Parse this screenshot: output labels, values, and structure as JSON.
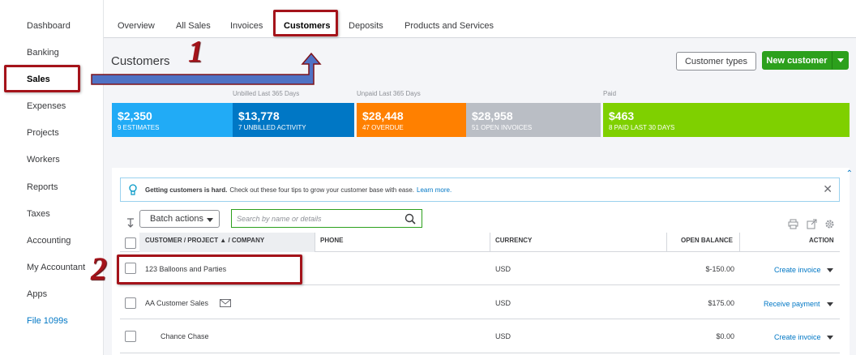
{
  "sidebar": {
    "items": [
      {
        "label": "Dashboard"
      },
      {
        "label": "Banking"
      },
      {
        "label": "Sales"
      },
      {
        "label": "Expenses"
      },
      {
        "label": "Projects"
      },
      {
        "label": "Workers"
      },
      {
        "label": "Reports"
      },
      {
        "label": "Taxes"
      },
      {
        "label": "Accounting"
      },
      {
        "label": "My Accountant"
      },
      {
        "label": "Apps"
      },
      {
        "label": "File 1099s"
      }
    ],
    "active": "Sales"
  },
  "tabs": [
    {
      "label": "Overview"
    },
    {
      "label": "All Sales"
    },
    {
      "label": "Invoices"
    },
    {
      "label": "Customers"
    },
    {
      "label": "Deposits"
    },
    {
      "label": "Products and Services"
    }
  ],
  "header": {
    "title": "Customers",
    "customer_types_label": "Customer types",
    "new_customer_label": "New customer"
  },
  "money_bar": {
    "labels": {
      "unbilled": "Unbilled Last 365 Days",
      "unpaid": "Unpaid Last 365 Days",
      "paid": "Paid"
    },
    "blocks": [
      {
        "amount": "$2,350",
        "sub": "9 ESTIMATES",
        "color": "#21abf6"
      },
      {
        "amount": "$13,778",
        "sub": "7 UNBILLED ACTIVITY",
        "color": "#0077c5"
      },
      {
        "amount": "$28,448",
        "sub": "47 OVERDUE",
        "color": "#ff8000"
      },
      {
        "amount": "$28,958",
        "sub": "51 OPEN INVOICES",
        "color": "#babec5"
      },
      {
        "amount": "$463",
        "sub": "8 PAID LAST 30 DAYS",
        "color": "#7fd000"
      }
    ]
  },
  "tip": {
    "bold": "Getting customers is hard.",
    "text": "Check out these four tips to grow your customer base with ease.",
    "link": "Learn more."
  },
  "toolbar": {
    "batch_actions_label": "Batch actions",
    "search_placeholder": "Search by name or details"
  },
  "table": {
    "columns": {
      "customer": "CUSTOMER / PROJECT ▲ / COMPANY",
      "phone": "PHONE",
      "currency": "CURRENCY",
      "balance": "OPEN BALANCE",
      "action": "ACTION"
    },
    "rows": [
      {
        "name": "123 Balloons and Parties",
        "currency": "USD",
        "balance": "$-150.00",
        "action": "Create invoice"
      },
      {
        "name": "AA Customer Sales",
        "currency": "USD",
        "balance": "$175.00",
        "action": "Receive payment"
      },
      {
        "name": "Chance Chase",
        "currency": "USD",
        "balance": "$0.00",
        "action": "Create invoice"
      }
    ]
  },
  "annotations": {
    "step1": "1",
    "step2": "2"
  },
  "colors": {
    "annotation_red": "#a4131a",
    "annotation_blue": "#4f72c4",
    "brand_green": "#2ca01c",
    "link_blue": "#0077c5"
  }
}
